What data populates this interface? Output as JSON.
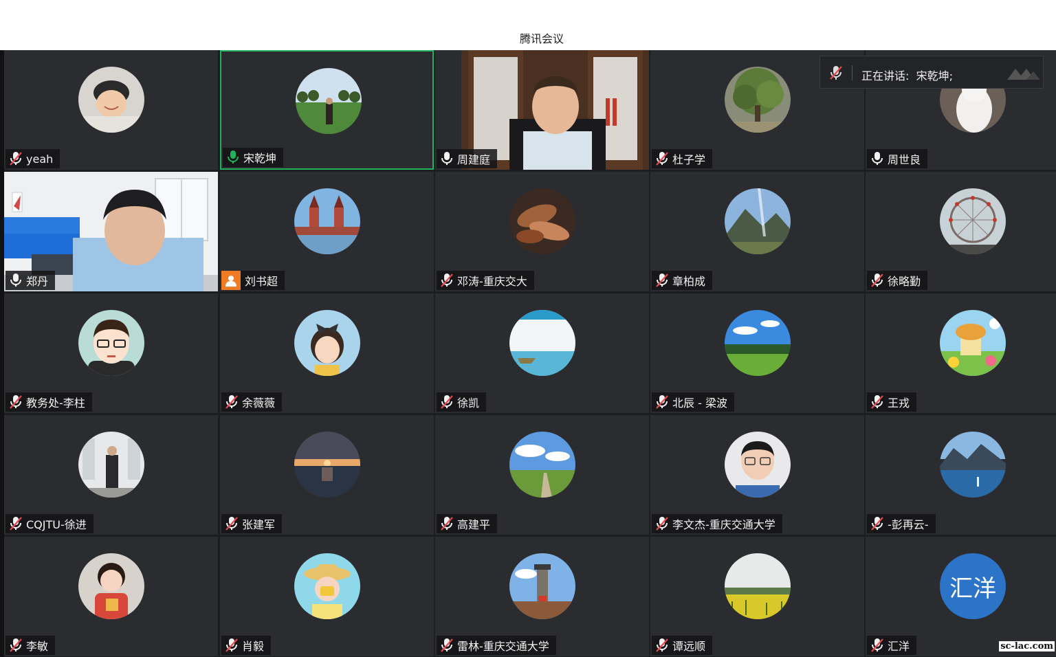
{
  "window": {
    "title": "腾讯会议"
  },
  "speaking": {
    "label": "正在讲话:",
    "name": "宋乾坤;"
  },
  "watermark": "sc-lac.com",
  "colors": {
    "active_border": "#21b05c",
    "mic_on": "#21b05c",
    "user_badge": "#ef7c22",
    "tile_bg": "#2b2c30",
    "logo_blue": "#2c74c8"
  },
  "participants": [
    {
      "name": "yeah",
      "mic": "muted",
      "media": "avatar",
      "picture": "person-face"
    },
    {
      "name": "宋乾坤",
      "mic": "speaking",
      "media": "avatar",
      "picture": "park-path",
      "active": true
    },
    {
      "name": "周建庭",
      "mic": "on",
      "media": "video",
      "picture": "man-bookshelf"
    },
    {
      "name": "杜子学",
      "mic": "muted",
      "media": "avatar",
      "picture": "tree"
    },
    {
      "name": "周世良",
      "mic": "on",
      "media": "avatar",
      "picture": "white-cat"
    },
    {
      "name": "郑丹",
      "mic": "on",
      "media": "video",
      "picture": "man-living-room"
    },
    {
      "name": "刘书超",
      "mic": "none",
      "media": "avatar",
      "picture": "bridge-towers"
    },
    {
      "name": "邓涛-重庆交大",
      "mic": "muted",
      "media": "avatar",
      "picture": "hands"
    },
    {
      "name": "章柏成",
      "mic": "muted",
      "media": "avatar",
      "picture": "mountain-rays"
    },
    {
      "name": "徐略勤",
      "mic": "muted",
      "media": "avatar",
      "picture": "ferris-wheel"
    },
    {
      "name": "教务处-李柱",
      "mic": "muted",
      "media": "avatar",
      "picture": "cartoon-man"
    },
    {
      "name": "余薇薇",
      "mic": "muted",
      "media": "avatar",
      "picture": "girl-bow"
    },
    {
      "name": "徐凯",
      "mic": "muted",
      "media": "avatar",
      "picture": "boat-lake"
    },
    {
      "name": "北辰 - 梁波",
      "mic": "muted",
      "media": "avatar",
      "picture": "golf-field"
    },
    {
      "name": "王戎",
      "mic": "muted",
      "media": "avatar",
      "picture": "cartoon-house"
    },
    {
      "name": "CQJTU-徐进",
      "mic": "muted",
      "media": "avatar",
      "picture": "man-hall"
    },
    {
      "name": "张建军",
      "mic": "muted",
      "media": "avatar",
      "picture": "sunset-sea"
    },
    {
      "name": "高建平",
      "mic": "muted",
      "media": "avatar",
      "picture": "road-hills"
    },
    {
      "name": "李文杰-重庆交通大学",
      "mic": "muted",
      "media": "avatar",
      "picture": "man-glasses"
    },
    {
      "name": "-彭再云-",
      "mic": "muted",
      "media": "avatar",
      "picture": "mountain-lake"
    },
    {
      "name": "李敏",
      "mic": "muted",
      "media": "avatar",
      "picture": "child-red"
    },
    {
      "name": "肖毅",
      "mic": "muted",
      "media": "avatar",
      "picture": "child-hat"
    },
    {
      "name": "雷林-重庆交通大学",
      "mic": "muted",
      "media": "avatar",
      "picture": "tower-temple"
    },
    {
      "name": "谭远顺",
      "mic": "muted",
      "media": "avatar",
      "picture": "rapeseed-field"
    },
    {
      "name": "汇洋",
      "mic": "muted",
      "media": "logo",
      "logo_text": "汇洋"
    }
  ]
}
